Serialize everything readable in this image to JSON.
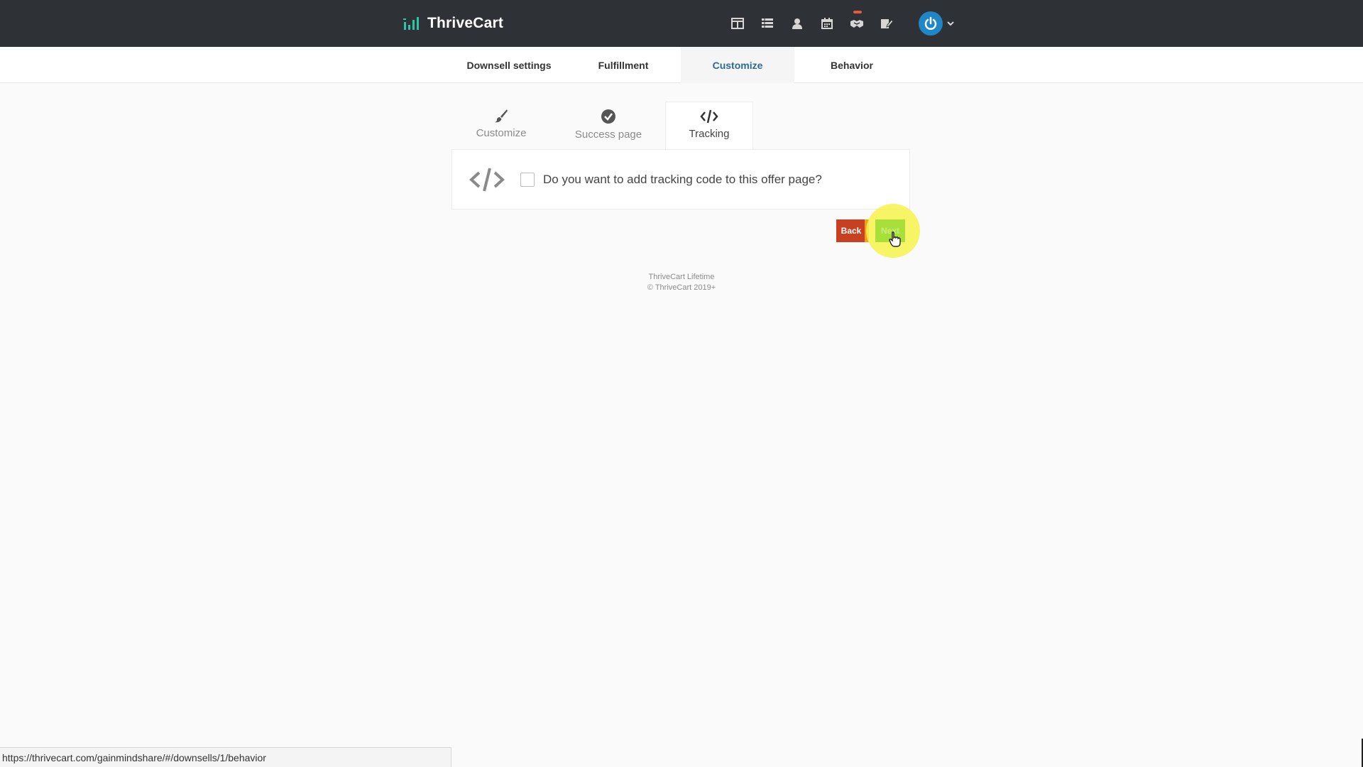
{
  "app": {
    "brand": "ThriveCart",
    "brand_color": "#2ec4a6"
  },
  "topbar": {
    "nav_icons": [
      "layout-icon",
      "list-icon",
      "user-icon",
      "calendar-icon",
      "handshake-icon",
      "edit-icon"
    ],
    "account_icon": "power-icon"
  },
  "main_tabs": [
    {
      "label": "Downsell settings",
      "active": false
    },
    {
      "label": "Fulfillment",
      "active": false
    },
    {
      "label": "Customize",
      "active": true
    },
    {
      "label": "Behavior",
      "active": false
    }
  ],
  "sub_tabs": [
    {
      "label": "Customize",
      "icon": "brush-icon",
      "active": false
    },
    {
      "label": "Success page",
      "icon": "check-circle-icon",
      "active": false
    },
    {
      "label": "Tracking",
      "icon": "code-icon",
      "active": true
    }
  ],
  "panel": {
    "question": "Do you want to add tracking code to this offer page?",
    "checked": false
  },
  "buttons": {
    "back": "Back",
    "next": "Next"
  },
  "footer": {
    "line1": "ThriveCart Lifetime",
    "line2": "© ThriveCart 2019+"
  },
  "status_url": "https://thrivecart.com/gainmindshare/#/downsells/1/behavior"
}
